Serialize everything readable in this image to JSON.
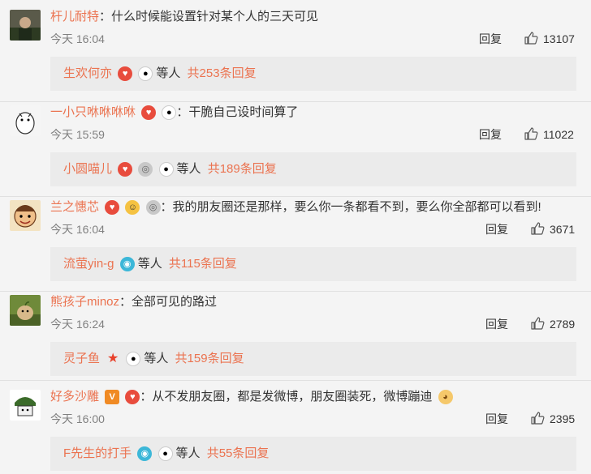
{
  "comments": [
    {
      "user": "杆儿耐特",
      "text": "什么时候能设置针对某个人的三天可见",
      "time": "今天 16:04",
      "reply_label": "回复",
      "likes": "13107",
      "sub": {
        "user": "生欢何亦",
        "deng": "等人",
        "total": "共253条回复"
      }
    },
    {
      "user": "一小只咻咻咻咻",
      "text": "干脆自己设时间算了",
      "time": "今天 15:59",
      "reply_label": "回复",
      "likes": "11022",
      "sub": {
        "user": "小圆喵儿",
        "deng": "等人",
        "total": "共189条回复"
      }
    },
    {
      "user": "兰之憓芯",
      "text": "我的朋友圈还是那样，要么你一条都看不到，要么你全部都可以看到!",
      "time": "今天 16:04",
      "reply_label": "回复",
      "likes": "3671",
      "sub": {
        "user": "流萤yin-g",
        "deng": "等人",
        "total": "共115条回复"
      }
    },
    {
      "user": "熊孩子minoz",
      "text": "全部可见的路过",
      "time": "今天 16:24",
      "reply_label": "回复",
      "likes": "2789",
      "sub": {
        "user": "灵子鱼",
        "deng": "等人",
        "total": "共159条回复"
      }
    },
    {
      "user": "好多沙雕",
      "text": "从不发朋友圈，都是发微博，朋友圈装死，微博蹦迪",
      "time": "今天 16:00",
      "reply_label": "回复",
      "likes": "2395",
      "sub": {
        "user": "F先生的打手",
        "deng": "等人",
        "total": "共55条回复"
      }
    }
  ],
  "colors": {
    "username": "#eb7350",
    "link": "#eb7350",
    "meta": "#808080",
    "subbg": "#ebebeb"
  }
}
